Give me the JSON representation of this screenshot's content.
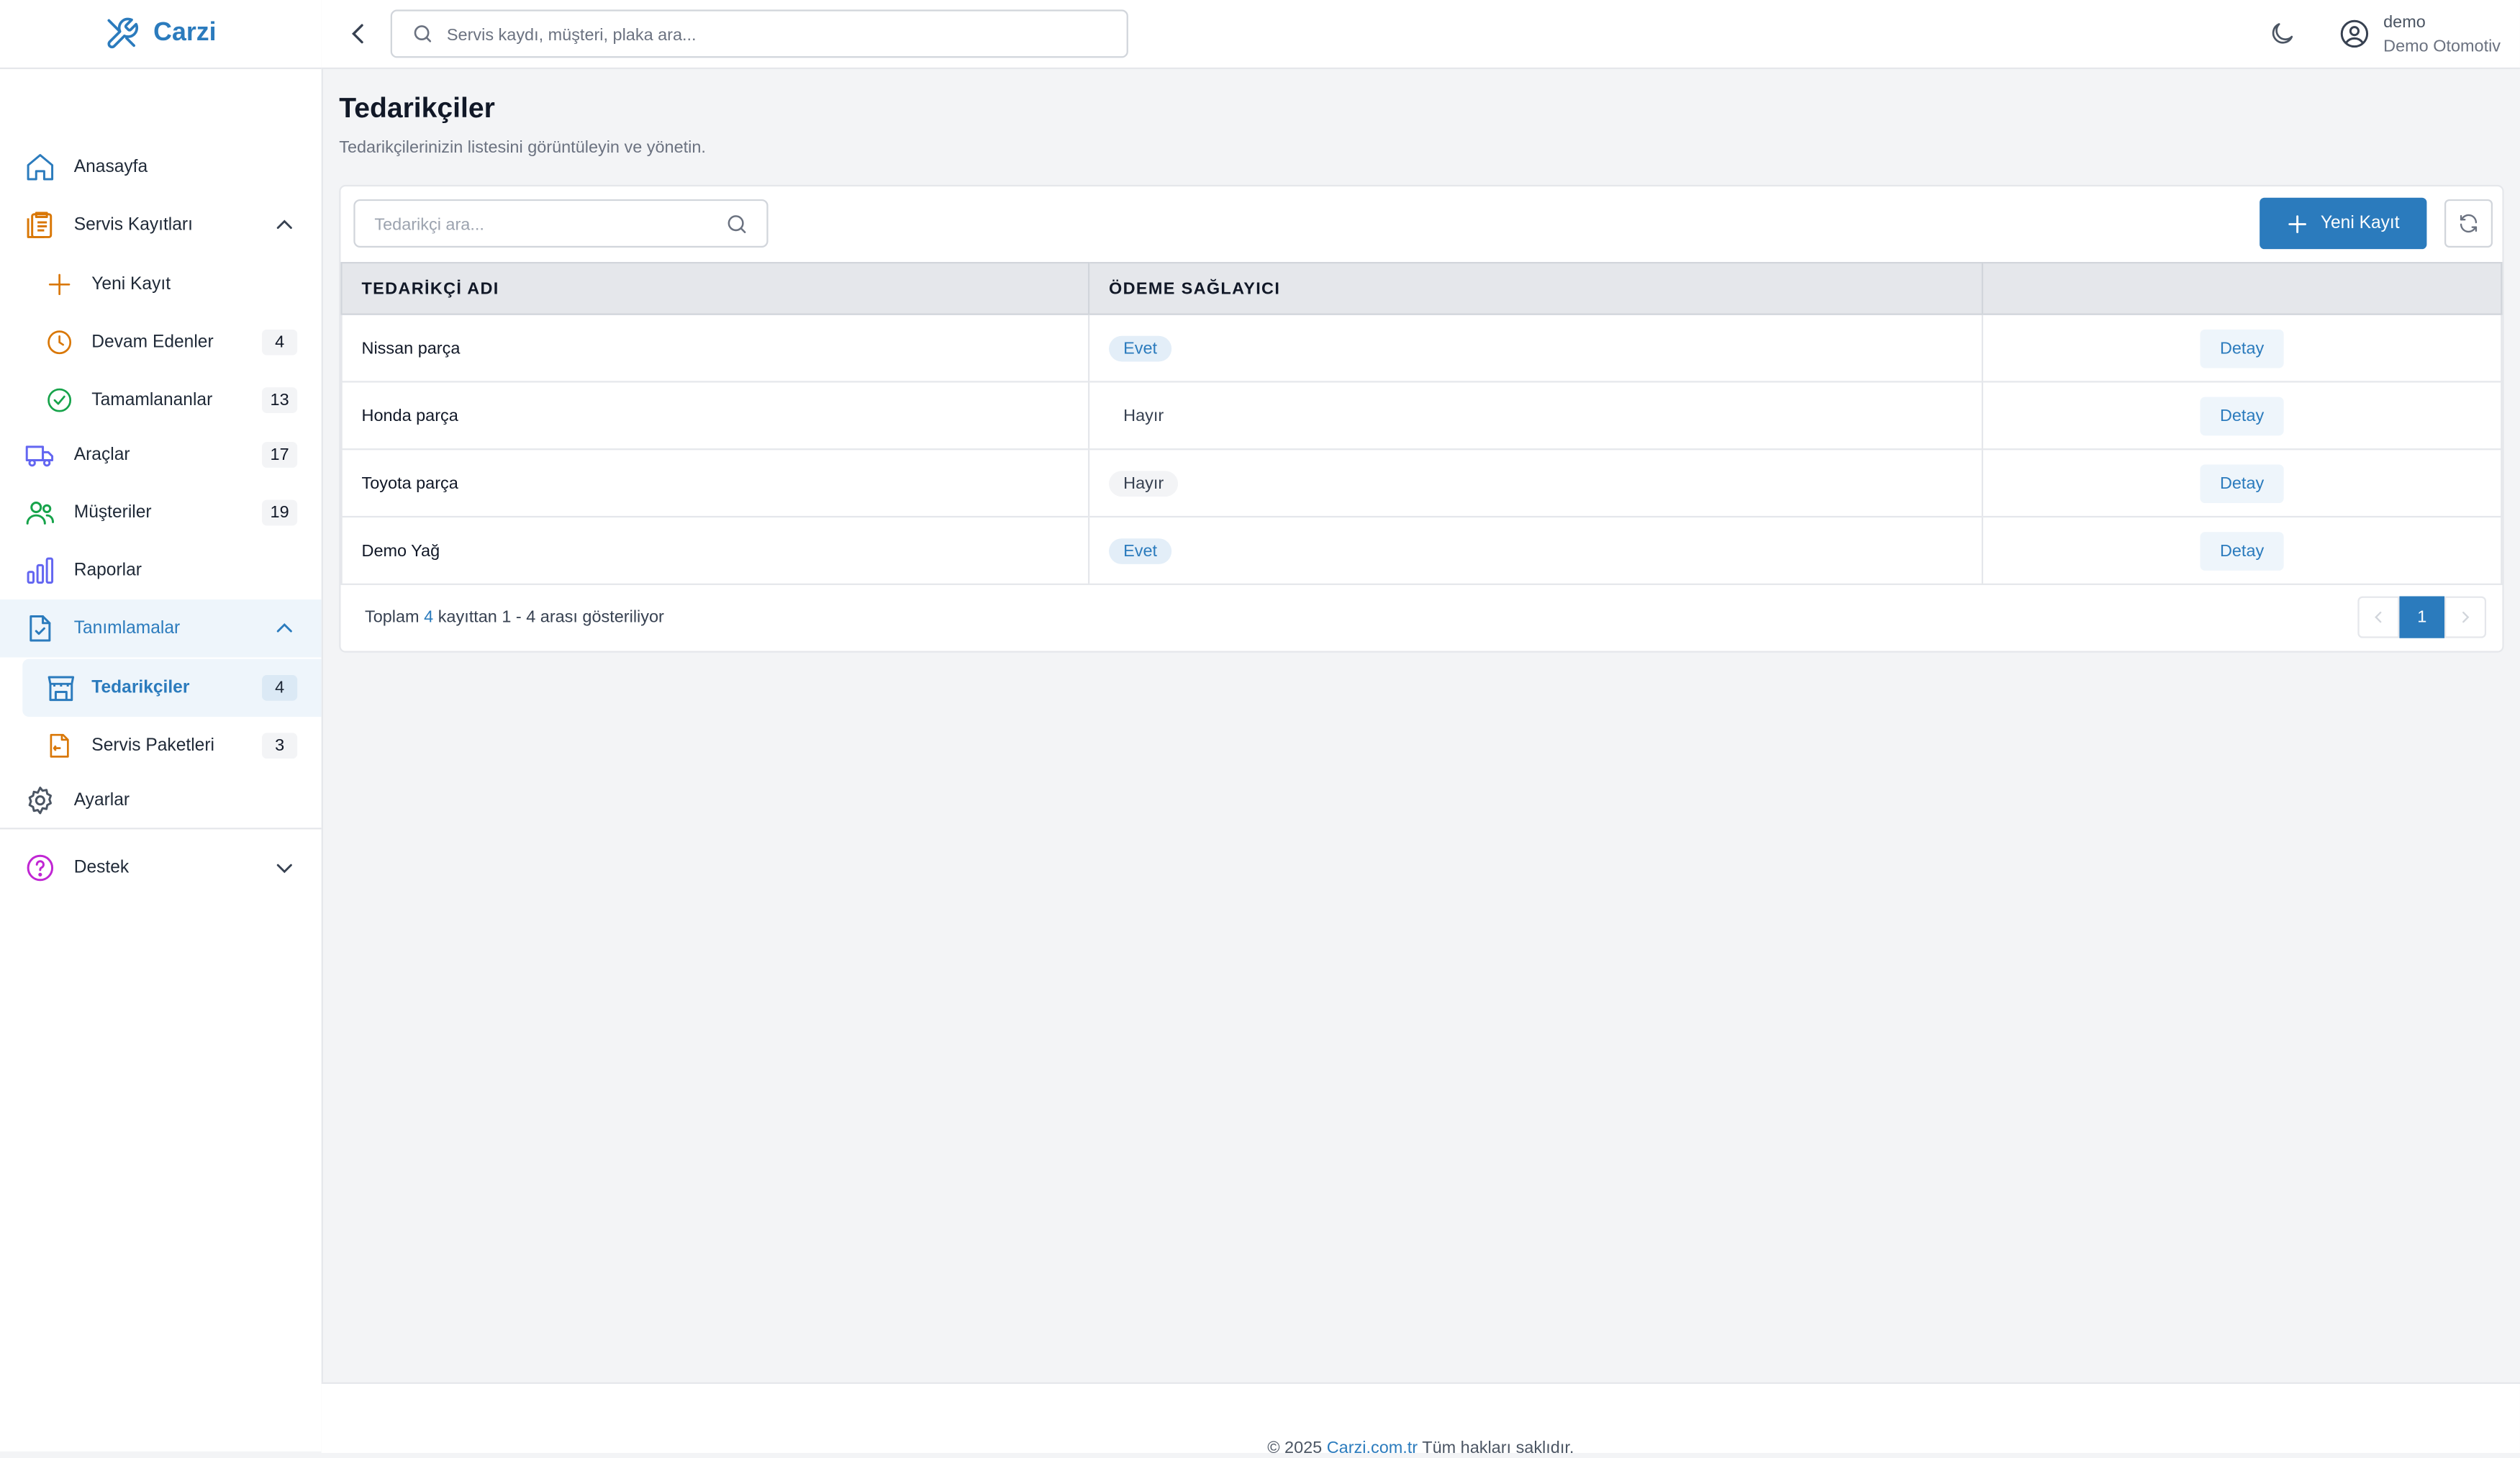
{
  "app": {
    "name": "Carzi"
  },
  "header": {
    "search_placeholder": "Servis kaydı, müşteri, plaka ara...",
    "user_name": "demo",
    "user_org": "Demo Otomotiv"
  },
  "sidebar": {
    "anasayfa": "Anasayfa",
    "servis": "Servis Kayıtları",
    "yeni_kayit": "Yeni Kayıt",
    "devam": {
      "label": "Devam Edenler",
      "count": "4"
    },
    "tamam": {
      "label": "Tamamlananlar",
      "count": "13"
    },
    "araclar": {
      "label": "Araçlar",
      "count": "17"
    },
    "musteriler": {
      "label": "Müşteriler",
      "count": "19"
    },
    "raporlar": "Raporlar",
    "tanimlamalar": "Tanımlamalar",
    "tedarikciler": {
      "label": "Tedarikçiler",
      "count": "4"
    },
    "paketler": {
      "label": "Servis Paketleri",
      "count": "3"
    },
    "ayarlar": "Ayarlar",
    "destek": "Destek"
  },
  "main": {
    "title": "Tedarikçiler",
    "subtitle": "Tedarikçilerinizin listesini görüntüleyin ve yönetin.",
    "search_placeholder": "Tedarikçi ara...",
    "new_button": "Yeni Kayıt",
    "columns": [
      "TEDARİKÇİ ADI",
      "ÖDEME SAĞLAYICI",
      ""
    ],
    "rows": [
      {
        "name": "Nissan parça",
        "payment": "Evet",
        "action": "Detay"
      },
      {
        "name": "Honda parça",
        "payment": "Hayır",
        "action": "Detay"
      },
      {
        "name": "Toyota parça",
        "payment": "Hayır",
        "action": "Detay"
      },
      {
        "name": "Demo Yağ",
        "payment": "Evet",
        "action": "Detay"
      }
    ],
    "summary": {
      "prefix": "Toplam",
      "total": "4",
      "suffix": "kayıttan 1 - 4 arası gösteriliyor"
    },
    "pager": {
      "current": "1"
    }
  },
  "footer": {
    "prefix": "© 2025",
    "link": "Carzi.com.tr",
    "suffix": "Tüm hakları saklıdır."
  },
  "colors": {
    "accent": "#2b7bbd",
    "background": "#f3f4f6"
  }
}
